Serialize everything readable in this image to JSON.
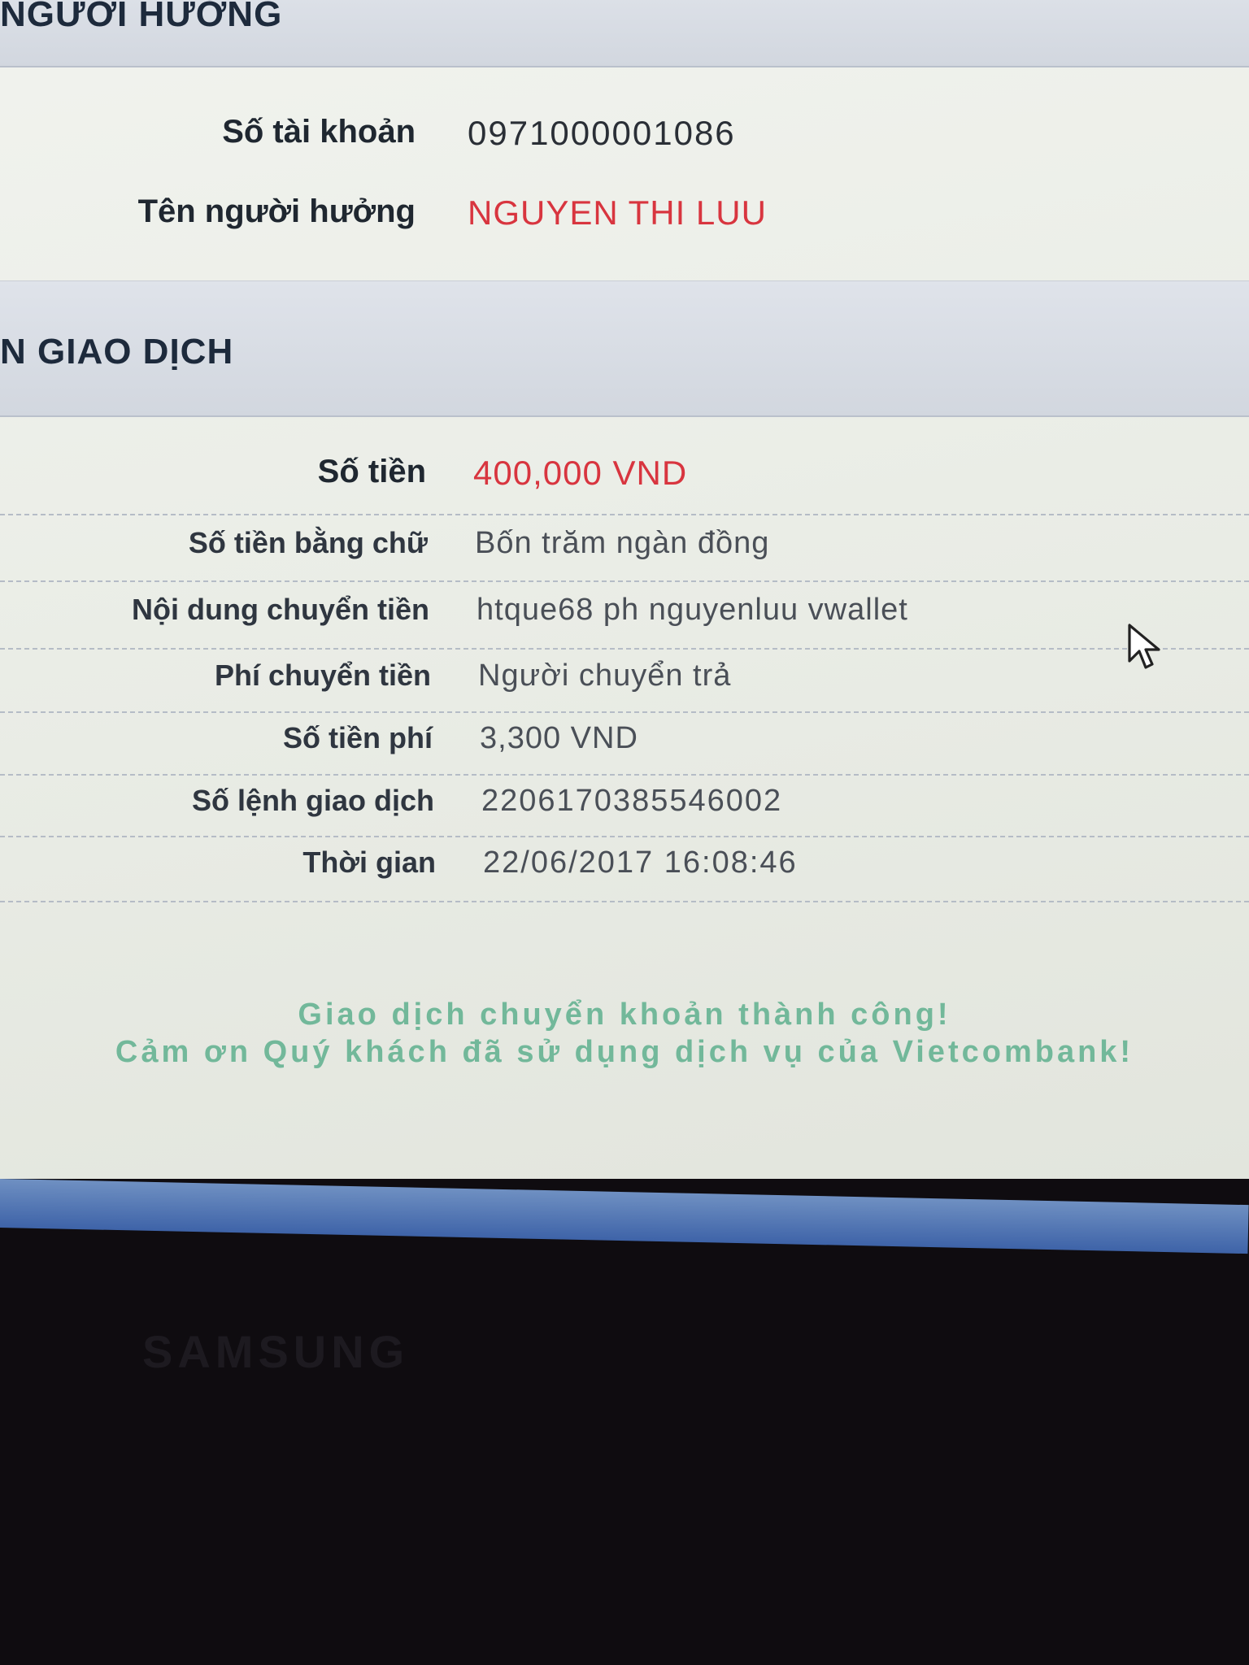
{
  "recipient_section": {
    "title": "NGƯỜI HƯỞNG",
    "account_number_label": "Số tài khoản",
    "account_number_value": "0971000001086",
    "beneficiary_name_label": "Tên người hưởng",
    "beneficiary_name_value": "NGUYEN THI LUU"
  },
  "transaction_section": {
    "title": "N GIAO DỊCH",
    "rows": [
      {
        "label": "Số tiền",
        "value": "400,000 VND"
      },
      {
        "label": "Số tiền bằng chữ",
        "value": "Bốn trăm ngàn đồng"
      },
      {
        "label": "Nội dung chuyển tiền",
        "value": "htque68 ph nguyenluu vwallet"
      },
      {
        "label": "Phí chuyển tiền",
        "value": "Người chuyển trả"
      },
      {
        "label": "Số tiền phí",
        "value": "3,300 VND"
      },
      {
        "label": "Số lệnh giao dịch",
        "value": "2206170385546002"
      },
      {
        "label": "Thời gian",
        "value": "22/06/2017 16:08:46"
      }
    ]
  },
  "success_message": {
    "line1": "Giao dịch chuyển khoản thành công!",
    "line2": "Cảm ơn Quý khách đã sử dụng dịch vụ của Vietcombank!"
  },
  "bezel": {
    "brand": "SAMSUNG"
  },
  "colors": {
    "accent_red": "#d8353f",
    "success_green": "#72b89a",
    "header_blue": "#1d2a3c"
  },
  "icons": {
    "cursor": "mouse-pointer-icon"
  }
}
